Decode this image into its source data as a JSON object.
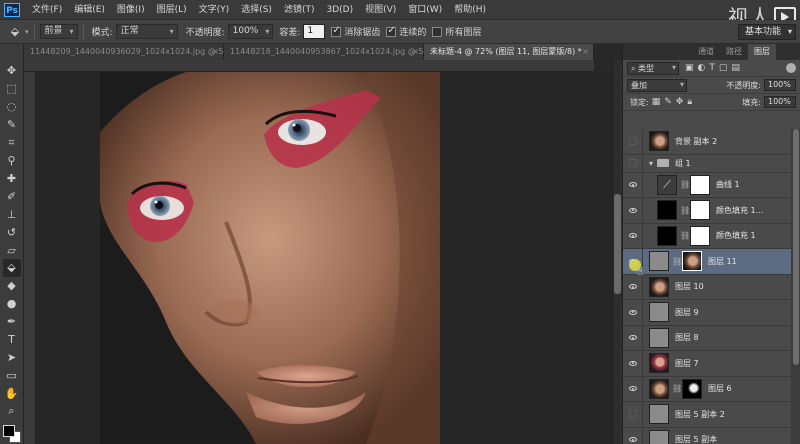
{
  "menu": {
    "logo": "Ps",
    "items": [
      "文件(F)",
      "编辑(E)",
      "图像(I)",
      "图层(L)",
      "文字(Y)",
      "选择(S)",
      "滤镜(T)",
      "3D(D)",
      "视图(V)",
      "窗口(W)",
      "帮助(H)"
    ]
  },
  "watermark": {
    "text": "视人"
  },
  "options": {
    "preset_label": "前景",
    "mode_label": "模式:",
    "mode_value": "正常",
    "opacity_label": "不透明度:",
    "opacity_value": "100%",
    "tolerance_label": "容差:",
    "tolerance_value": "1",
    "antialias_label": "消除锯齿",
    "contiguous_label": "连续的",
    "all_layers_label": "所有图层",
    "workspace_label": "基本功能"
  },
  "tabs": [
    {
      "label": "11448209_1440040936029_1024x1024.jpg @ 50.8...",
      "active": false
    },
    {
      "label": "11448218_1440040953867_1024x1024.jpg @ 50% ...",
      "active": false
    },
    {
      "label": "未标题-4 @ 72% (图层 11, 图层蒙版/8) *",
      "active": true
    }
  ],
  "panel": {
    "tabs": [
      {
        "label": "通道",
        "active": false
      },
      {
        "label": "路径",
        "active": false
      },
      {
        "label": "图层",
        "active": true
      }
    ],
    "kind_filter": "类型",
    "blend_mode": "叠加",
    "opacity_label": "不透明度:",
    "opacity_value": "100%",
    "lock_label": "锁定:",
    "fill_label": "填充:",
    "fill_value": "100%"
  },
  "layers": [
    {
      "name": "背景 副本 2",
      "visible": false,
      "thumb": "face",
      "mask": null,
      "type": "normal",
      "indent": false,
      "selected": false
    },
    {
      "name": "组 1",
      "visible": false,
      "thumb": null,
      "mask": null,
      "type": "group",
      "indent": false,
      "selected": false
    },
    {
      "name": "曲线 1",
      "visible": true,
      "thumb": "adj",
      "mask": "white",
      "type": "adjust",
      "indent": true,
      "selected": false
    },
    {
      "name": "颜色填充 1...",
      "visible": true,
      "thumb": "black",
      "mask": "white",
      "type": "fill",
      "indent": true,
      "selected": false
    },
    {
      "name": "颜色填充 1",
      "visible": true,
      "thumb": "black",
      "mask": "white",
      "type": "fill",
      "indent": true,
      "selected": false
    },
    {
      "name": "图层 11",
      "visible": true,
      "thumb": "gray",
      "mask": "face",
      "type": "normal",
      "indent": false,
      "selected": true
    },
    {
      "name": "图层 10",
      "visible": true,
      "thumb": "face",
      "mask": null,
      "type": "normal",
      "indent": false,
      "selected": false
    },
    {
      "name": "图层 9",
      "visible": true,
      "thumb": "gray",
      "mask": null,
      "type": "normal",
      "indent": false,
      "selected": false
    },
    {
      "name": "图层 8",
      "visible": true,
      "thumb": "gray",
      "mask": null,
      "type": "normal",
      "indent": false,
      "selected": false
    },
    {
      "name": "图层 7",
      "visible": true,
      "thumb": "face-red",
      "mask": null,
      "type": "normal",
      "indent": false,
      "selected": false
    },
    {
      "name": "图层 6",
      "visible": true,
      "thumb": "face",
      "mask": "dark",
      "type": "normal",
      "indent": false,
      "selected": false
    },
    {
      "name": "图层 5 副本 2",
      "visible": false,
      "thumb": "gray",
      "mask": null,
      "type": "normal",
      "indent": false,
      "selected": false
    },
    {
      "name": "图层 5 副本",
      "visible": true,
      "thumb": "gray",
      "mask": null,
      "type": "normal",
      "indent": false,
      "selected": false
    }
  ]
}
